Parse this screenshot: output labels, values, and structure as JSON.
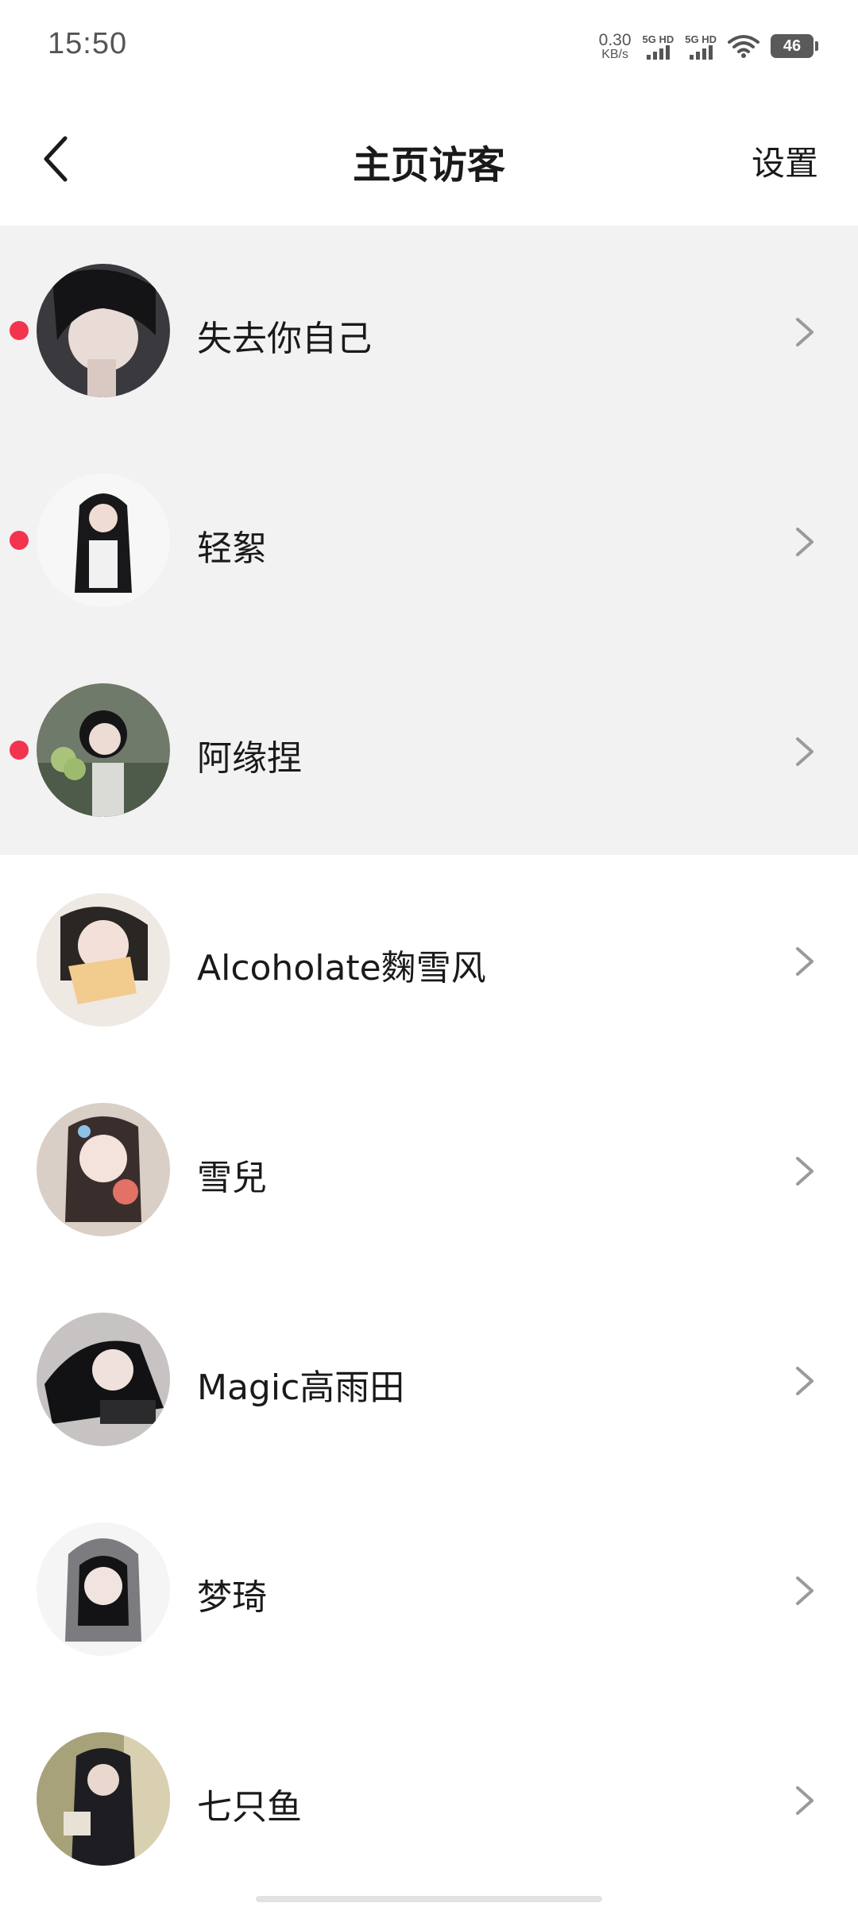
{
  "status_bar": {
    "time": "15:50",
    "net_speed_value": "0.30",
    "net_speed_unit": "KB/s",
    "sim1_label": "5G HD",
    "sim2_label": "5G HD",
    "battery": "46"
  },
  "nav": {
    "title": "主页访客",
    "settings_label": "设置",
    "back_icon": "chevron-left-icon"
  },
  "colors": {
    "unread_background": "#f2f2f3",
    "unread_dot": "#f2344f",
    "chevron": "#9a9a9a"
  },
  "visitors": [
    {
      "name": "失去你自己",
      "unread": true
    },
    {
      "name": "轻絮",
      "unread": true
    },
    {
      "name": "阿缘捏",
      "unread": true
    },
    {
      "name": "Alcoholate麴雪风",
      "unread": false
    },
    {
      "name": "雪兒",
      "unread": false
    },
    {
      "name": "Magic高雨田",
      "unread": false
    },
    {
      "name": "梦琦",
      "unread": false
    },
    {
      "name": "七只鱼",
      "unread": false
    }
  ]
}
